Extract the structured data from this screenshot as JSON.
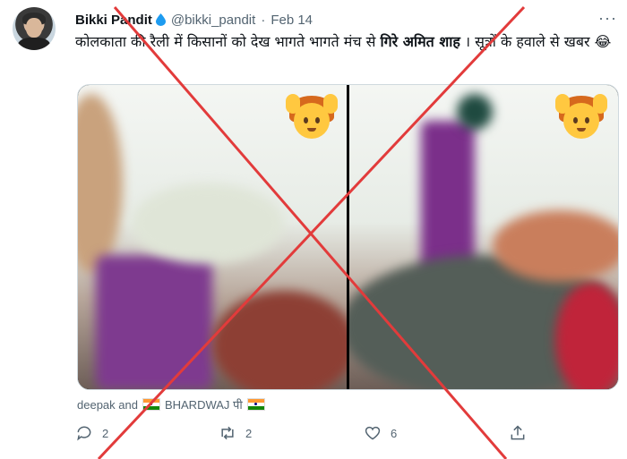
{
  "tweet": {
    "display_name": "Bikki Pandit",
    "handle": "@bikki_pandit",
    "separator": "·",
    "date": "Feb 14",
    "more_label": "···",
    "text_part1": "कोलकाता की रैली में किसानों को देख भागते भागते मंच से ",
    "text_bold": "गिरे अमित शाह",
    "text_part2": " । सूत्रों के हवाले से खबर 😂",
    "media_emoji_left": "🙆",
    "media_emoji_right": "🙆"
  },
  "likers": {
    "prefix": "deepak and",
    "name": "BHARDWAJ पी"
  },
  "actions": {
    "reply_count": "2",
    "retweet_count": "2",
    "like_count": "6",
    "share_label": ""
  },
  "icons": {
    "verified_drop": "water-drop-icon",
    "reply": "reply-icon",
    "retweet": "retweet-icon",
    "like": "heart-icon",
    "share": "share-icon"
  },
  "colors": {
    "cross": "#e23b3b",
    "muted": "#536471",
    "drop": "#1d9bf0"
  }
}
